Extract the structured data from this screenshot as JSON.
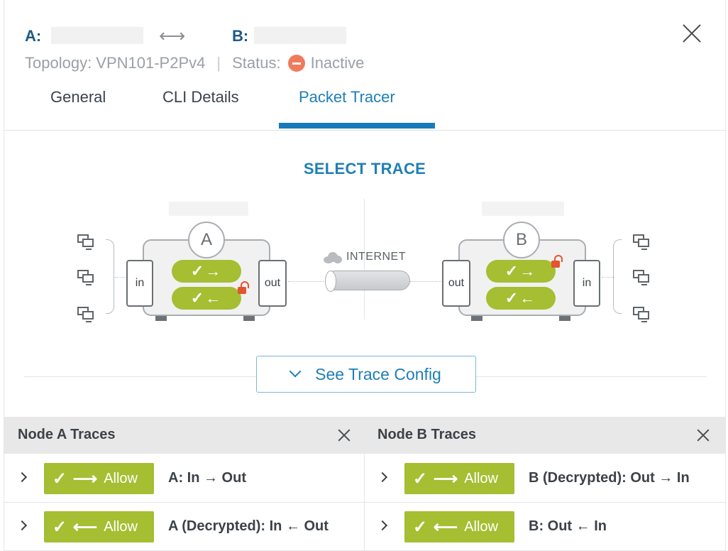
{
  "header": {
    "a_label": "A:",
    "b_label": "B:",
    "link_arrow": "⟷",
    "topology": "Topology: VPN101-P2Pv4",
    "separator": "|",
    "status_label": "Status:",
    "status_value": "Inactive",
    "status_color": "#f07b5c"
  },
  "tabs": [
    {
      "label": "General"
    },
    {
      "label": "CLI Details"
    },
    {
      "label": "Packet Tracer"
    }
  ],
  "active_tab": "Packet Tracer",
  "accent_color": "#1f7fb5",
  "allow_color": "#a5be32",
  "section_title": "SELECT TRACE",
  "diagram": {
    "node_a": {
      "letter": "A",
      "in_label": "in",
      "out_label": "out",
      "forward_glyph": "✓→",
      "reverse_glyph": "✓←"
    },
    "node_b": {
      "letter": "B",
      "in_label": "in",
      "out_label": "out",
      "forward_glyph": "✓→",
      "reverse_glyph": "✓←"
    },
    "internet_label": "INTERNET"
  },
  "see_trace_config": "See Trace Config",
  "node_a_traces": {
    "title": "Node A Traces",
    "rows": [
      {
        "glyph": "✓ ⟶",
        "action": "Allow",
        "label": "A: In → Out"
      },
      {
        "glyph": "✓ ⟵",
        "action": "Allow",
        "label": "A (Decrypted): In ← Out"
      }
    ]
  },
  "node_b_traces": {
    "title": "Node B Traces",
    "rows": [
      {
        "glyph": "✓ ⟶",
        "action": "Allow",
        "label": "B (Decrypted): Out → In"
      },
      {
        "glyph": "✓ ⟵",
        "action": "Allow",
        "label": "B: Out ← In"
      }
    ]
  }
}
